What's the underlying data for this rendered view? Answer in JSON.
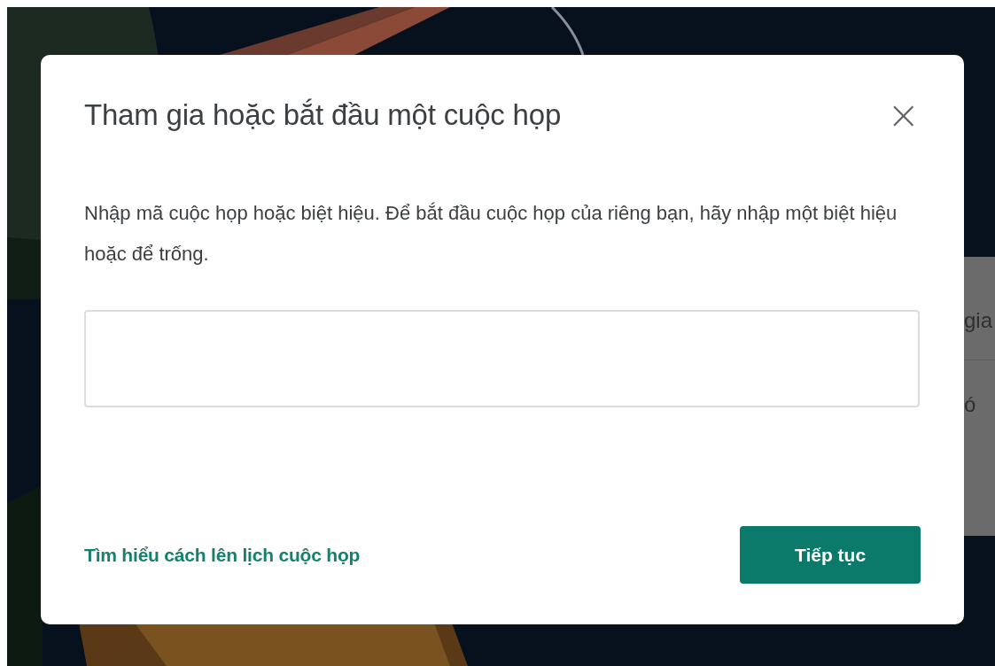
{
  "background_panel": {
    "lines": [
      "gia",
      "ó"
    ]
  },
  "dialog": {
    "title": "Tham gia hoặc bắt đầu một cuộc họp",
    "close": "×",
    "description": "Nhập mã cuộc họp hoặc biệt hiệu. Để bắt đầu cuộc họp của riêng bạn, hãy nhập một biệt hiệu hoặc để trống.",
    "link": "Tìm hiểu cách lên lịch cuộc họp",
    "button": "Tiếp tục"
  }
}
